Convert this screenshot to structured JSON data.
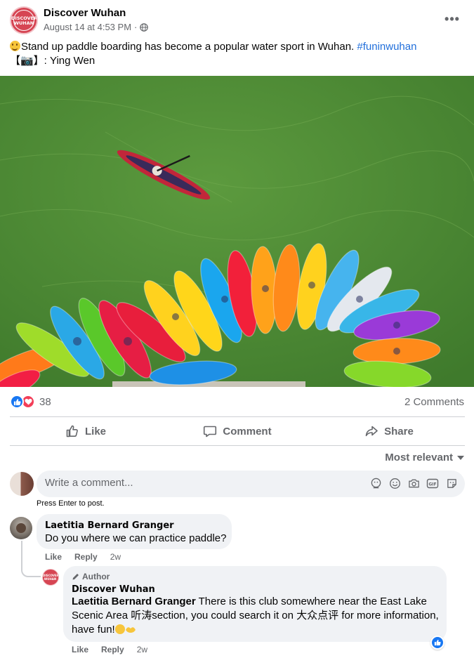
{
  "post": {
    "page_name": "Discover Wuhan",
    "page_logo_text": [
      "DISCOVER",
      "WUHAN"
    ],
    "timestamp": "August 14 at 4:53 PM",
    "meta_separator": "·",
    "more_label": "•••",
    "caption_line1": "Stand up paddle boarding has become a popular water sport in Wuhan.",
    "hashtag": "#funinwuhan",
    "caption_line2": "【📷】: Ying Wen"
  },
  "stats": {
    "reaction_count": "38",
    "comments_label": "2 Comments"
  },
  "actions": {
    "like": "Like",
    "comment": "Comment",
    "share": "Share"
  },
  "sort": {
    "label": "Most relevant"
  },
  "composer": {
    "placeholder": "Write a comment...",
    "hint": "Press Enter to post."
  },
  "comments": [
    {
      "author": "Laetitia Bernard Granger",
      "text": "Do you where we can practice paddle?",
      "like": "Like",
      "reply": "Reply",
      "time": "2w"
    }
  ],
  "reply": {
    "badge": "Author",
    "author": "Discover Wuhan",
    "mention": "Laetitia Bernard Granger",
    "text_line1": "There is this club somewhere near the East Lake",
    "text_line2": "Scenic Area 听涛section, you could search it on 大众点评 for more information,",
    "text_line3": "have fun!",
    "like": "Like",
    "reply": "Reply",
    "time": "2w"
  },
  "colors": {
    "accent": "#1877f2",
    "love": "#f33e58",
    "hashtag": "#216fdb",
    "secondary_text": "#65676b",
    "bubble": "#f0f2f5",
    "water": "#4f8a35"
  }
}
